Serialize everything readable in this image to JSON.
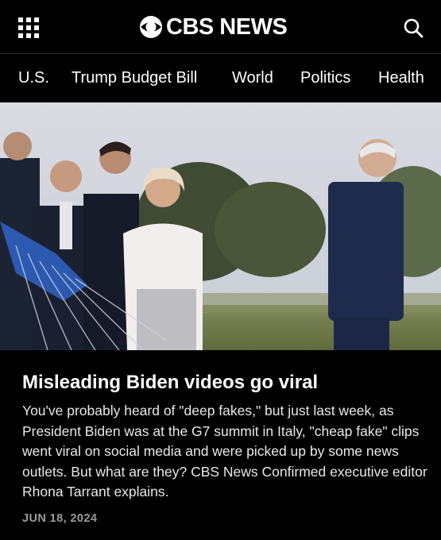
{
  "header": {
    "logo_text": "CBS NEWS",
    "menu_icon": "grid-menu-icon",
    "search_icon": "search-icon"
  },
  "nav": {
    "items": [
      "U.S.",
      "Trump Budget Bill",
      "World",
      "Politics",
      "Health"
    ]
  },
  "article": {
    "image_icon": "video-thumbnail",
    "headline": "Misleading Biden videos go viral",
    "summary": "You've probably heard of \"deep fakes,\" but just last week, as President Biden was at the G7 summit in Italy, \"cheap fake\" clips went viral on social media and were picked up by some news outlets. But what are they? CBS News Confirmed executive editor Rhona Tarrant explains.",
    "date": "JUN 18, 2024"
  },
  "colors": {
    "background": "#000000",
    "text": "#ffffff",
    "muted": "#9a9a9a"
  }
}
